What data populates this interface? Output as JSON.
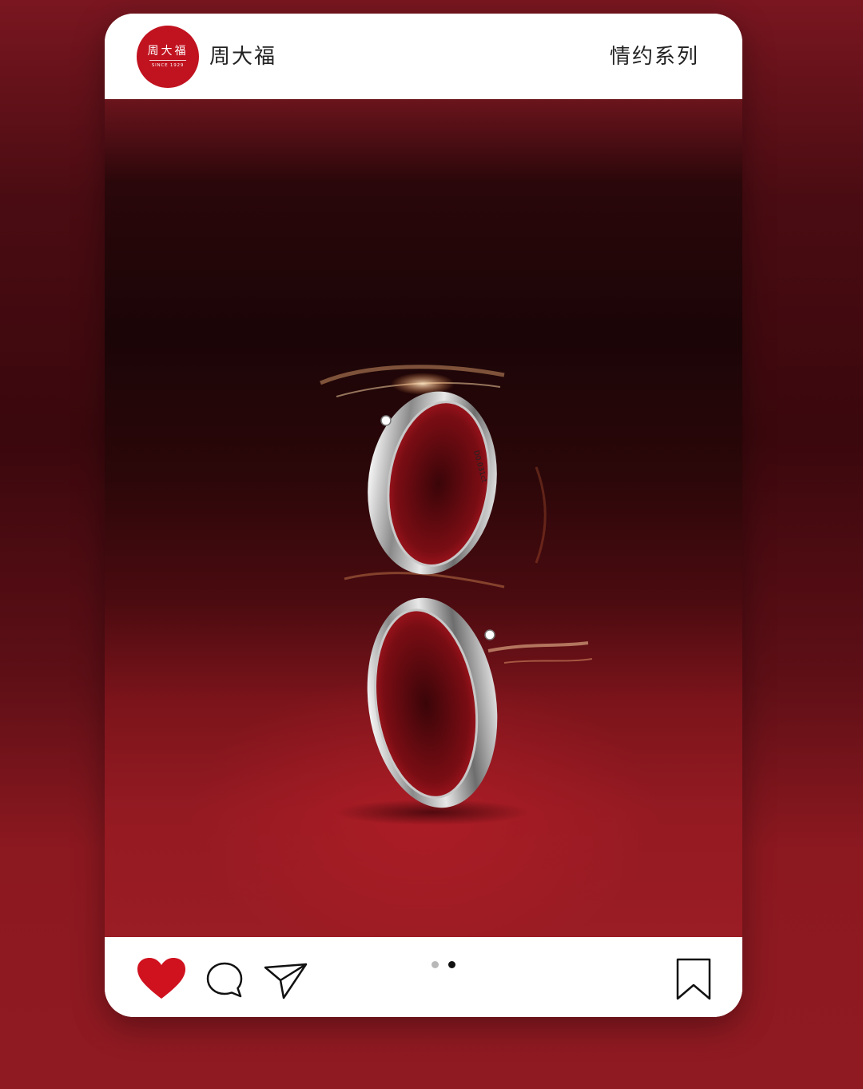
{
  "header": {
    "logo_text_cn": "周大福",
    "logo_text_en": "SINCE 1929",
    "brand_name": "周大福",
    "series_title": "情约系列"
  },
  "photo": {
    "ring_engraving": "D0.031ct"
  },
  "footer": {
    "like_icon": "heart-icon",
    "comment_icon": "comment-bubble-icon",
    "share_icon": "send-paper-plane-icon",
    "save_icon": "bookmark-icon",
    "carousel": {
      "total": 2,
      "active_index": 1
    }
  },
  "colors": {
    "brand_red": "#c1121f",
    "heart_red": "#d0121f",
    "dot_inactive": "#b8b8b8",
    "dot_active": "#111111"
  }
}
